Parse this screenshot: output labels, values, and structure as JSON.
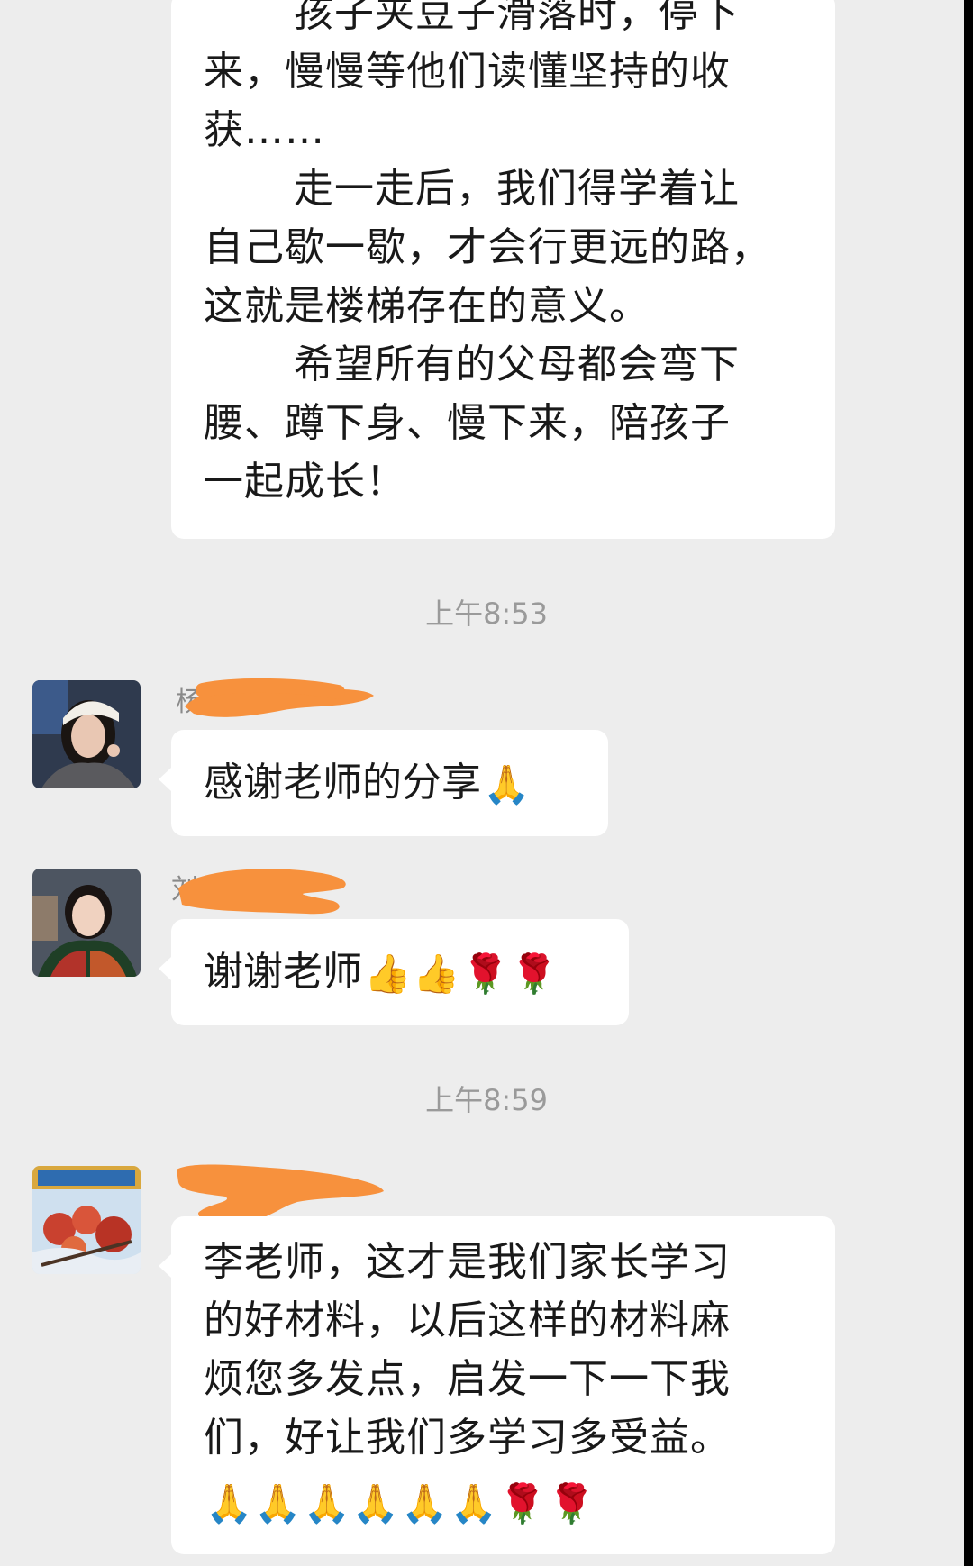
{
  "top_message": {
    "lines": [
      {
        "text": "孩子夹豆子滑落时，停下",
        "indent": true
      },
      {
        "text": "来，慢慢等他们读懂坚持的收",
        "indent": false
      },
      {
        "text": "获……",
        "indent": false
      },
      {
        "text": "走一走后，我们得学着让",
        "indent": true
      },
      {
        "text": "自己歇一歇，才会行更远的路，",
        "indent": false
      },
      {
        "text": "这就是楼梯存在的意义。",
        "indent": false
      },
      {
        "text": "希望所有的父母都会弯下",
        "indent": true
      },
      {
        "text": "腰、蹲下身、慢下来，陪孩子",
        "indent": false
      },
      {
        "text": "一起成长！",
        "indent": false
      }
    ]
  },
  "timestamps": {
    "first": "上午8:53",
    "second": "上午8:59"
  },
  "messages": [
    {
      "sender_name": "杨",
      "text": "感谢老师的分享",
      "emojis": [
        {
          "char": "🙏",
          "kind": "pray",
          "icon": "pray-hands-icon"
        }
      ]
    },
    {
      "sender_name": "刘",
      "text": "谢谢老师",
      "emojis": [
        {
          "char": "👍",
          "kind": "thumb",
          "icon": "thumbs-up-icon"
        },
        {
          "char": "👍",
          "kind": "thumb",
          "icon": "thumbs-up-icon"
        },
        {
          "char": "🌹",
          "kind": "rose",
          "icon": "rose-icon"
        },
        {
          "char": "🌹",
          "kind": "rose",
          "icon": "rose-icon"
        }
      ]
    },
    {
      "sender_name": "",
      "lines": [
        "李老师，这才是我们家长学习",
        "的好材料，以后这样的材料麻",
        "烦您多发点，启发一下一下我",
        "们，好让我们多学习多受益。"
      ],
      "emojis": [
        {
          "char": "🙏",
          "kind": "pray",
          "icon": "pray-hands-icon"
        },
        {
          "char": "🙏",
          "kind": "pray",
          "icon": "pray-hands-icon"
        },
        {
          "char": "🙏",
          "kind": "pray",
          "icon": "pray-hands-icon"
        },
        {
          "char": "🙏",
          "kind": "pray",
          "icon": "pray-hands-icon"
        },
        {
          "char": "🙏",
          "kind": "pray",
          "icon": "pray-hands-icon"
        },
        {
          "char": "🙏",
          "kind": "pray",
          "icon": "pray-hands-icon"
        },
        {
          "char": "🌹",
          "kind": "rose",
          "icon": "rose-icon"
        },
        {
          "char": "🌹",
          "kind": "rose",
          "icon": "rose-icon"
        }
      ]
    }
  ],
  "colors": {
    "background": "#ededed",
    "bubble": "#ffffff",
    "text": "#191919",
    "timestamp": "#9a9a9a",
    "redaction": "#f7913d"
  }
}
